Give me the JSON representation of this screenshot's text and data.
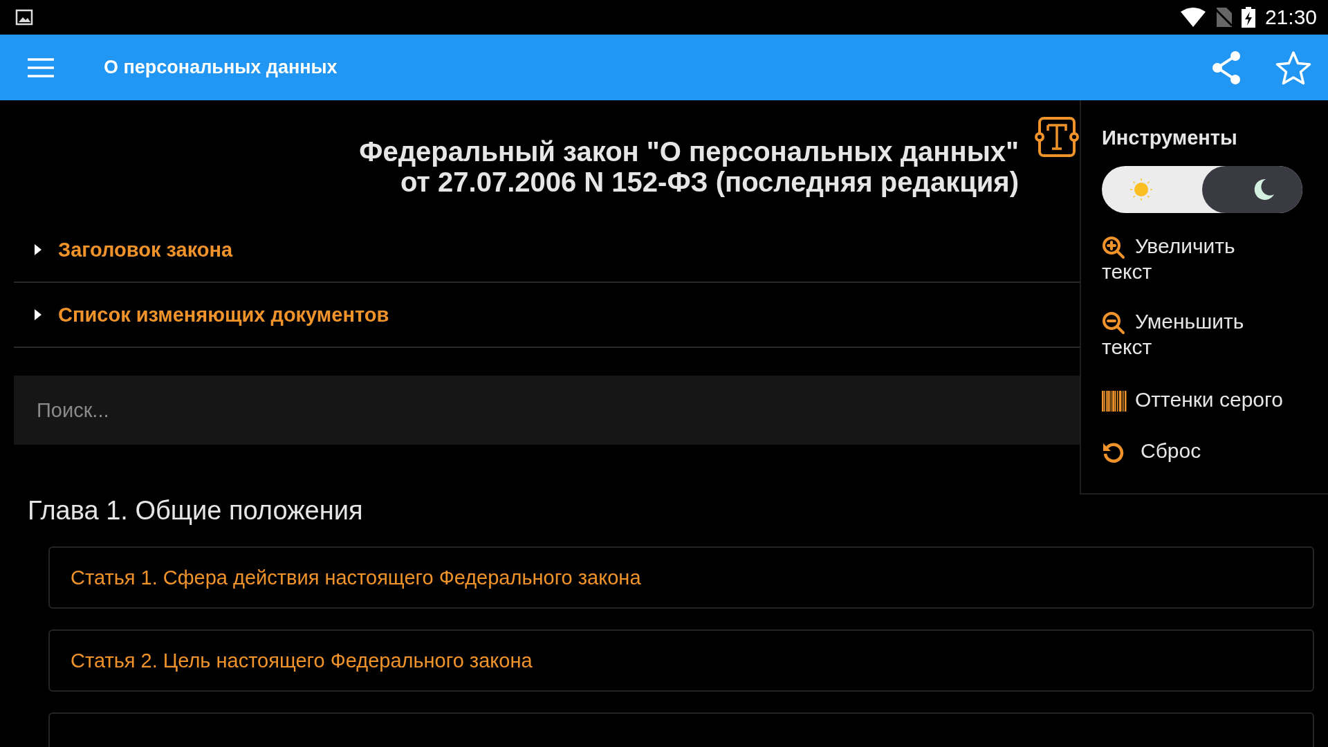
{
  "status_bar": {
    "time": "21:30"
  },
  "app_bar": {
    "title": "О персональных данных"
  },
  "document": {
    "title_lines": [
      "Федеральный закон \"О персональных данных\"",
      "от 27.07.2006 N 152-ФЗ (последняя редакция)"
    ]
  },
  "sections": [
    {
      "label": "Заголовок закона",
      "expanded": false
    },
    {
      "label": "Список изменяющих документов",
      "expanded": false
    }
  ],
  "search": {
    "placeholder": "Поиск..."
  },
  "chapter": {
    "title": "Глава 1. Общие положения"
  },
  "articles": [
    "Статья 1. Сфера действия настоящего Федерального закона",
    "Статья 2. Цель настоящего Федерального закона"
  ],
  "tools_menu": {
    "title": "Инструменты",
    "dark_mode": true,
    "items": [
      {
        "kind": "zoom_in",
        "label": "Увеличить текст"
      },
      {
        "kind": "zoom_out",
        "label": "Уменьшить текст"
      },
      {
        "kind": "grayscale",
        "label": "Оттенки серого"
      },
      {
        "kind": "reset",
        "label": "Сброс"
      }
    ]
  }
}
